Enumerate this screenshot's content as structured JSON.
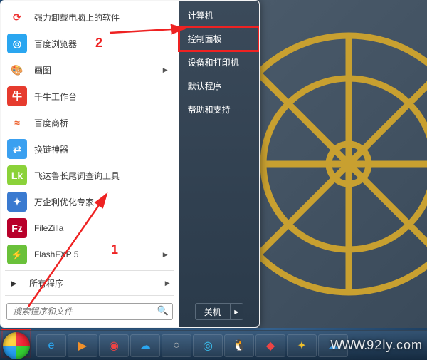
{
  "annotations": {
    "num1": "1",
    "num2": "2"
  },
  "start_menu": {
    "left": {
      "apps": [
        {
          "label": "强力卸载电脑上的软件",
          "icon": "uninstall-icon",
          "bg": "#fff",
          "fg": "#e33",
          "glyph": "⟳",
          "submenu": false
        },
        {
          "label": "百度浏览器",
          "icon": "baidu-browser-icon",
          "bg": "#2aa6f0",
          "fg": "#fff",
          "glyph": "◎",
          "submenu": false
        },
        {
          "label": "画图",
          "icon": "paint-icon",
          "bg": "#fff",
          "fg": "#d46",
          "glyph": "🎨",
          "submenu": true
        },
        {
          "label": "千牛工作台",
          "icon": "qianniu-icon",
          "bg": "#e63b2e",
          "fg": "#fff",
          "glyph": "牛",
          "submenu": false
        },
        {
          "label": "百度商桥",
          "icon": "baidu-bridge-icon",
          "bg": "#fff",
          "fg": "#e63",
          "glyph": "≈",
          "submenu": false
        },
        {
          "label": "换链神器",
          "icon": "link-tool-icon",
          "bg": "#3aa0f0",
          "fg": "#fff",
          "glyph": "⇄",
          "submenu": false
        },
        {
          "label": "飞达鲁长尾词查询工具",
          "icon": "longkey-icon",
          "bg": "#8bd23a",
          "fg": "#fff",
          "glyph": "Lk",
          "submenu": false
        },
        {
          "label": "万企利优化专家",
          "icon": "optimize-icon",
          "bg": "#3a7ad0",
          "fg": "#fff",
          "glyph": "✦",
          "submenu": false
        },
        {
          "label": "FileZilla",
          "icon": "filezilla-icon",
          "bg": "#b8002a",
          "fg": "#fff",
          "glyph": "Fz",
          "submenu": false
        },
        {
          "label": "FlashFXP 5",
          "icon": "flashfxp-icon",
          "bg": "#6ac13a",
          "fg": "#fff",
          "glyph": "⚡",
          "submenu": true
        }
      ],
      "all_programs": "所有程序",
      "search_placeholder": "搜索程序和文件"
    },
    "right": {
      "items": [
        {
          "label": "计算机",
          "name": "computer"
        },
        {
          "label": "控制面板",
          "name": "control-panel",
          "highlighted": true
        },
        {
          "label": "设备和打印机",
          "name": "devices-printers"
        },
        {
          "label": "默认程序",
          "name": "default-programs"
        },
        {
          "label": "帮助和支持",
          "name": "help-support"
        }
      ],
      "shutdown": "关机"
    }
  },
  "taskbar": {
    "icons": [
      {
        "name": "ie-icon",
        "glyph": "e",
        "color": "#2aa6f0"
      },
      {
        "name": "media-player-icon",
        "glyph": "▶",
        "color": "#f0902a"
      },
      {
        "name": "chrome-icon",
        "glyph": "◉",
        "color": "#e44"
      },
      {
        "name": "baidu-cloud-icon",
        "glyph": "☁",
        "color": "#2aa6f0"
      },
      {
        "name": "browser2-icon",
        "glyph": "○",
        "color": "#bbb"
      },
      {
        "name": "browser3-icon",
        "glyph": "◎",
        "color": "#3ac0f0"
      },
      {
        "name": "qq-icon",
        "glyph": "🐧",
        "color": "#fff"
      },
      {
        "name": "app9-icon",
        "glyph": "◆",
        "color": "#e44"
      },
      {
        "name": "app10-icon",
        "glyph": "✦",
        "color": "#f0c02a"
      },
      {
        "name": "app11-icon",
        "glyph": "☁",
        "color": "#3aa0f0"
      }
    ]
  },
  "watermark": {
    "prefix": "WWW.",
    "text": "92ly",
    "suffix": ".com"
  }
}
